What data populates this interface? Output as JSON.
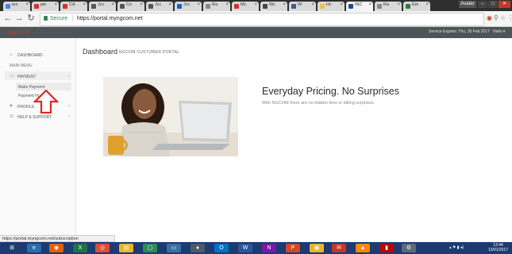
{
  "browser": {
    "tabs": [
      {
        "label": "tex",
        "color": "#4285f4"
      },
      {
        "label": "ple",
        "color": "#d93025"
      },
      {
        "label": "CA",
        "color": "#d93025"
      },
      {
        "label": "Jcc",
        "color": "#555555"
      },
      {
        "label": "Co",
        "color": "#555555"
      },
      {
        "label": "Jcc",
        "color": "#555555"
      },
      {
        "label": "Jcc",
        "color": "#0a66c2"
      },
      {
        "label": "Ra",
        "color": "#888888"
      },
      {
        "label": "Mc",
        "color": "#d93025"
      },
      {
        "label": "Wc",
        "color": "#444444"
      },
      {
        "label": "W",
        "color": "#3b5998"
      },
      {
        "label": "Hc",
        "color": "#f0c040"
      },
      {
        "label": "INC",
        "color": "#1a4aa0"
      },
      {
        "label": "Ra",
        "color": "#888888"
      },
      {
        "label": "Em",
        "color": "#2e7d32"
      }
    ],
    "active_tab_index": 12,
    "profile_label": "Avatar",
    "address": {
      "secure_label": "Secure",
      "url": "https://portal.myngcom.net"
    }
  },
  "site": {
    "logo_text": "ngcom",
    "service_expiry": "Service Expires: Thu, 30 Feb 2017",
    "hello": "Hello ▾"
  },
  "sidebar": {
    "dashboard": "DASHBOARD",
    "main_menu": "MAIN MENU",
    "payment": "PAYMENT",
    "make_payment": "Make Payment",
    "payment_history": "Payment Hi",
    "profile": "PROFILE",
    "help_support": "HELP & SUPPORT"
  },
  "main": {
    "title": "Dashboard",
    "subtitle": "NGCOM CUSTOMER PORTAL",
    "headline": "Everyday Pricing. No Surprises",
    "text": "With NGCOM there are no hidden fees or billing surprises."
  },
  "status": {
    "link": "https://portal.myngcom.net/subscription"
  },
  "taskbar": {
    "time": "13:44",
    "date": "13/01/2017"
  },
  "colors": {
    "header": "#4e5558",
    "arrow": "#e52420",
    "taskbar": "#1b3b72"
  }
}
